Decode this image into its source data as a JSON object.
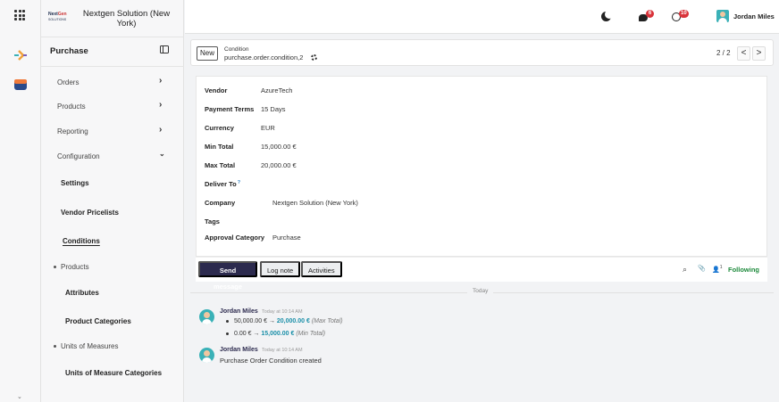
{
  "company": {
    "logo_text": "NextGen SOLUTIONS",
    "name": "Nextgen Solution (New York)"
  },
  "app": {
    "title": "Purchase"
  },
  "menu": {
    "orders": "Orders",
    "products": "Products",
    "reporting": "Reporting",
    "configuration": "Configuration",
    "settings": "Settings",
    "vendor_pricelists": "Vendor Pricelists",
    "conditions": "Conditions",
    "products_section": "Products",
    "attributes": "Attributes",
    "product_categories": "Product Categories",
    "uom_section": "Units of Measures",
    "uom_categories": "Units of Measure Categories"
  },
  "topbar": {
    "chat_badge": "6",
    "activity_badge": "10",
    "user_name": "Jordan Miles"
  },
  "control": {
    "new_label": "New",
    "breadcrumb": "Condition",
    "record_name": "purchase.order.condition,2",
    "pager": "2 / 2",
    "prev": "<",
    "next": ">"
  },
  "form": {
    "vendor_label": "Vendor",
    "vendor": "AzureTech",
    "payment_terms_label": "Payment Terms",
    "payment_terms": "15 Days",
    "currency_label": "Currency",
    "currency": "EUR",
    "min_total_label": "Min Total",
    "min_total": "15,000.00 €",
    "max_total_label": "Max Total",
    "max_total": "20,000.00 €",
    "deliver_to_label": "Deliver To",
    "deliver_to_help": "?",
    "company_label": "Company",
    "company": "Nextgen Solution (New York)",
    "tags_label": "Tags",
    "approval_label": "Approval Category",
    "approval": "Purchase"
  },
  "chatter": {
    "send_message": "Send message",
    "log_note": "Log note",
    "activities": "Activities",
    "search_icon": "⌕",
    "attach_icon": "📎",
    "followers_icon": "👤",
    "followers_count": "1",
    "following": "Following",
    "today": "Today",
    "messages": [
      {
        "author": "Jordan Miles",
        "time": "Today at 10:14 AM",
        "tracking": [
          {
            "old": "50,000.00 €",
            "arrow": "→",
            "new": "20,000.00 €",
            "field": "(Max Total)"
          },
          {
            "old": "0.00 €",
            "arrow": "→",
            "new": "15,000.00 €",
            "field": "(Min Total)"
          }
        ]
      },
      {
        "author": "Jordan Miles",
        "time": "Today at 10:14 AM",
        "body": "Purchase Order Condition created"
      }
    ]
  },
  "colors": {
    "primary": "#2c2a4e",
    "following": "#1e8a3c",
    "badge": "#d9343b",
    "tracking_new": "#1a8fa8"
  }
}
